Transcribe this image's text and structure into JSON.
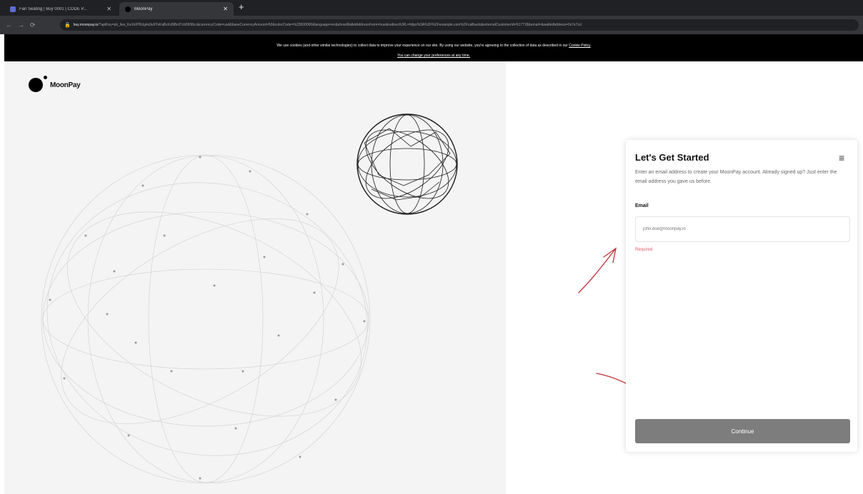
{
  "browser": {
    "tabs": [
      {
        "title": "Fan Seating | Buy 0001 | CODE P...",
        "active": false
      },
      {
        "title": "MoonPay",
        "active": true
      }
    ],
    "url_host": "buy.moonpay.io",
    "url_rest": "/?apiKey=pk_live_Ke1IrIP9Ug4s9u9YvKaBcKd9Brd7cb0938cc&currencyCode=usd&baseCurrencyAmount=50&colorCode=%23000000&language=en&showWalletAddressForm=true&redirectURL=https%3A%2F%2Fexample.com%2Fcallback&externalCustomerId=517718&email=&walletAddress=0x7e7cd"
  },
  "cookie_banner": {
    "line1": "We use cookies (and other similar technologies) to collect data to improve your experience on our site. By using our website, you're agreeing to the collection of data as described in our ",
    "policy_link": "Cookie Policy",
    "line2": "You can change your preferences at any time."
  },
  "brand": {
    "name": "MoonPay"
  },
  "form": {
    "title": "Let's Get Started",
    "subtitle": "Enter an email address to create your MoonPay account. Already signed up? Just enter the email address you gave us before.",
    "email_label": "Email",
    "email_value": "",
    "email_placeholder": "john.doe@moonpay.io",
    "error": "Required",
    "continue_label": "Continue"
  },
  "colors": {
    "banner_bg": "#000000",
    "panel_bg": "#f4f4f4",
    "button_bg": "#7d7d7d",
    "error_text": "#e05a6a",
    "annotation_arrow": "#c0303a"
  },
  "icons": [
    "moonpay-logo-icon",
    "hamburger-menu-icon",
    "reload-icon",
    "lock-icon",
    "new-tab-icon"
  ]
}
